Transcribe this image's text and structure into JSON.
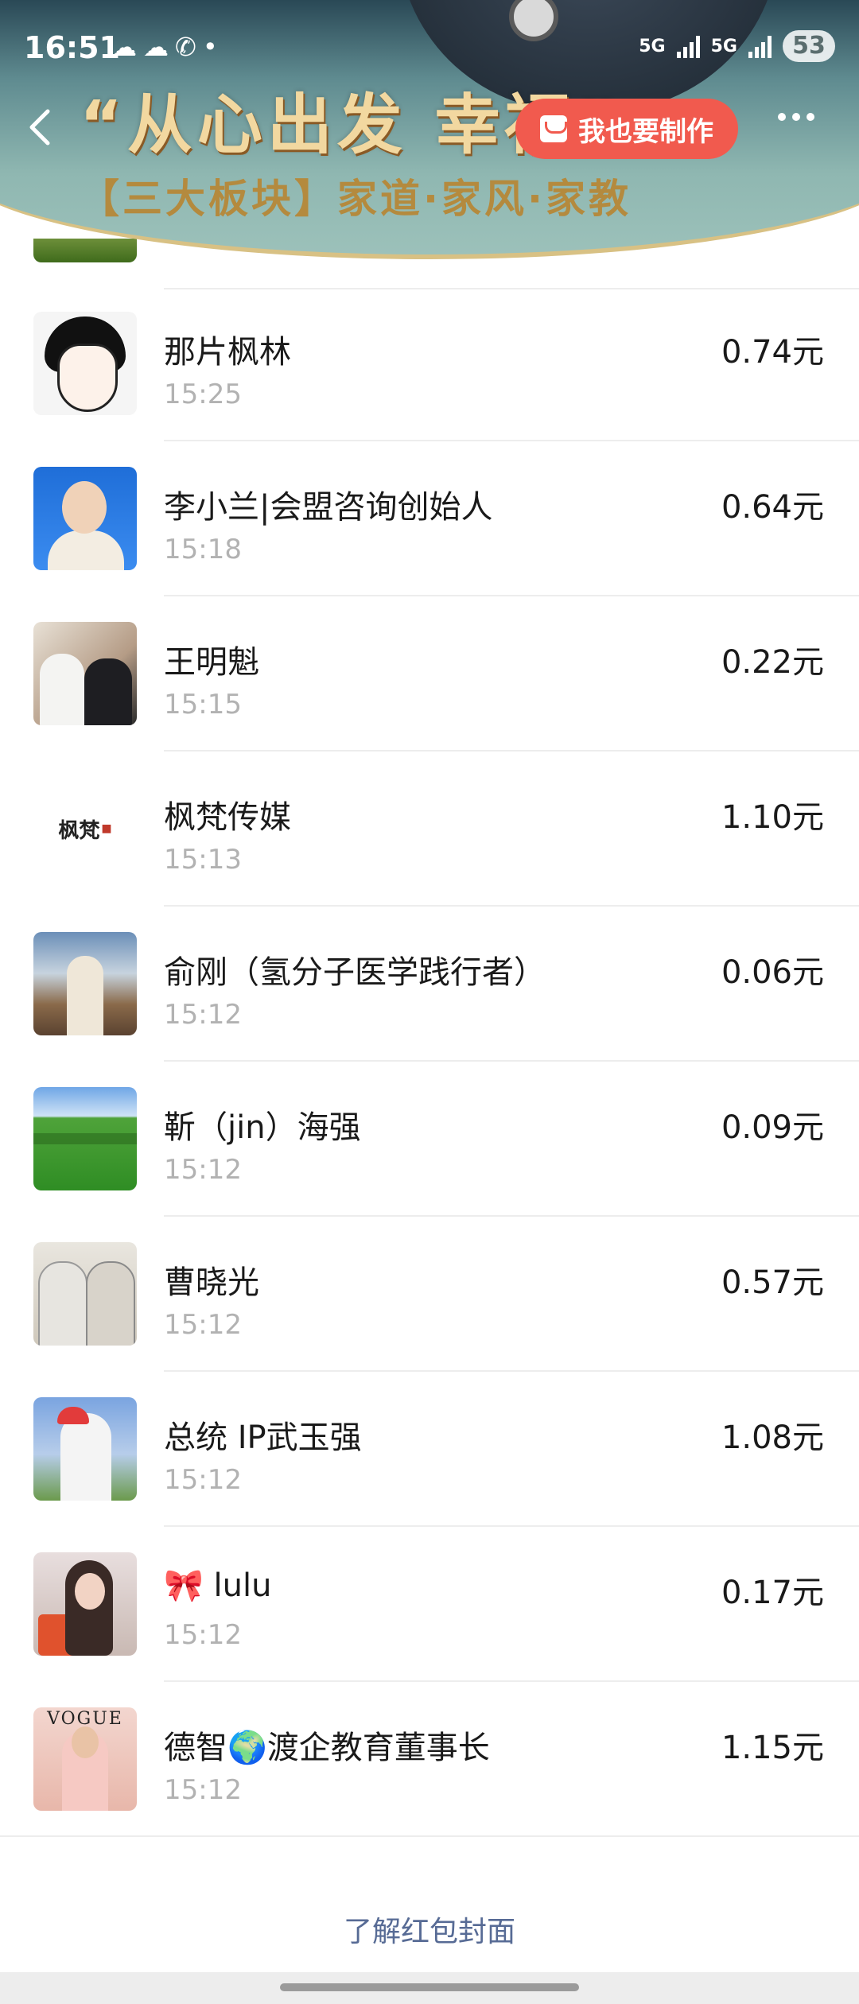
{
  "status_bar": {
    "time": "16:51",
    "network_1": "5G",
    "network_2": "5G",
    "battery": "53"
  },
  "banner": {
    "title": "“从心出发 幸福”",
    "subtitle": "【三大板块】家道·家风·家教",
    "make_button_label": "我也要制作"
  },
  "records": [
    {
      "name": "那片枫林",
      "time": "15:25",
      "amount": "0.74元",
      "avatar": "cartoon-avatar"
    },
    {
      "name": "李小兰|会盟咨询创始人",
      "time": "15:18",
      "amount": "0.64元",
      "avatar": "portrait-avatar"
    },
    {
      "name": "王明魁",
      "time": "15:15",
      "amount": "0.22元",
      "avatar": "photo-avatar"
    },
    {
      "name": "枫梵传媒",
      "time": "15:13",
      "amount": "1.10元",
      "avatar": "logo-avatar",
      "logo_text": "枫梵"
    },
    {
      "name": "俞刚（氢分子医学践行者）",
      "time": "15:12",
      "amount": "0.06元",
      "avatar": "mountain-avatar"
    },
    {
      "name": "靳（jin）海强",
      "time": "15:12",
      "amount": "0.09元",
      "avatar": "grassland-avatar"
    },
    {
      "name": "曹晓光",
      "time": "15:12",
      "amount": "0.57元",
      "avatar": "two-people-avatar"
    },
    {
      "name": "总统 IP武玉强",
      "time": "15:12",
      "amount": "1.08元",
      "avatar": "golf-avatar"
    },
    {
      "name_emoji": "🎀",
      "name": "lulu",
      "time": "15:12",
      "amount": "0.17元",
      "avatar": "girl-avatar"
    },
    {
      "name_prefix": "德智",
      "name_emoji": "🌍",
      "name": "渡企教育董事长",
      "time": "15:12",
      "amount": "1.15元",
      "avatar": "vogue-avatar",
      "avatar_text": "VOGUE"
    }
  ],
  "footer": {
    "link": "了解红包封面"
  },
  "colors": {
    "make_button": "#f15a4e",
    "link": "#576b95",
    "time_text": "#b2b2b2"
  }
}
